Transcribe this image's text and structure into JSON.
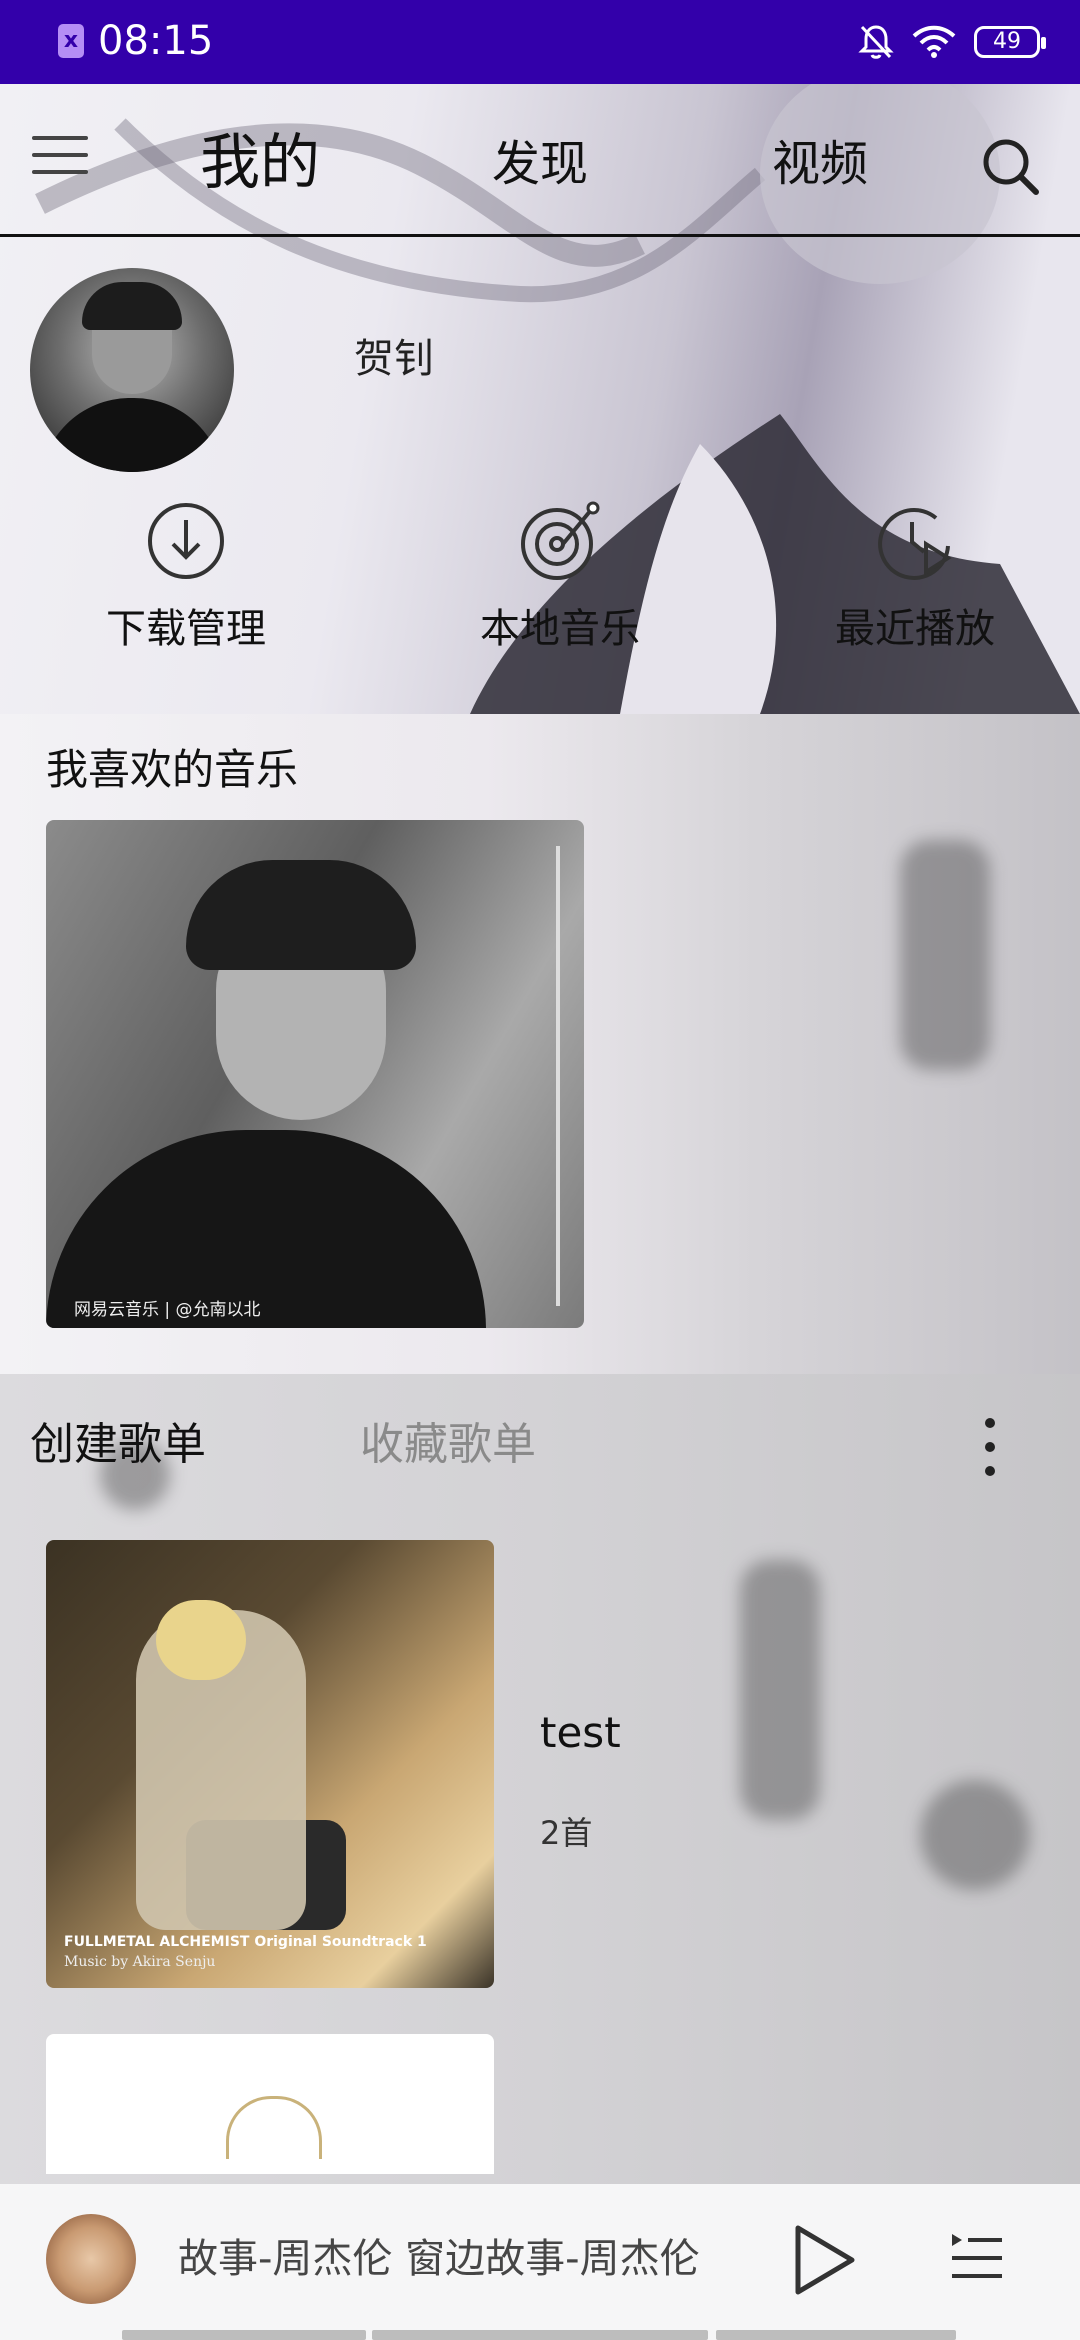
{
  "status_bar": {
    "time": "08:15",
    "app_icon": "x",
    "battery": "49",
    "icons": [
      "mute-bell-icon",
      "wifi-icon",
      "battery-icon"
    ],
    "background_color": "#3300aa"
  },
  "header": {
    "tabs": [
      {
        "label": "我的",
        "active": true
      },
      {
        "label": "发现",
        "active": false
      },
      {
        "label": "视频",
        "active": false
      }
    ],
    "icons": [
      "menu-icon",
      "search-icon"
    ]
  },
  "profile": {
    "username": "贺钊"
  },
  "quick_actions": [
    {
      "label": "下载管理",
      "icon": "download-icon"
    },
    {
      "label": "本地音乐",
      "icon": "vinyl-icon"
    },
    {
      "label": "最近播放",
      "icon": "recent-play-icon"
    }
  ],
  "favorites": {
    "title": "我喜欢的音乐",
    "watermark": "网易云音乐 | @允南以北"
  },
  "playlist_section": {
    "tabs": [
      {
        "label": "创建歌单",
        "active": true
      },
      {
        "label": "收藏歌单",
        "active": false
      }
    ],
    "items": [
      {
        "name": "test",
        "count": "2首",
        "cover_title": "FULLMETAL ALCHEMIST Original Soundtrack 1",
        "cover_subtitle": "Music by Akira Senju"
      }
    ]
  },
  "player": {
    "scrolling_text": "故事-周杰伦 窗边故事-周杰伦",
    "icons": [
      "play-icon",
      "playlist-icon"
    ]
  }
}
